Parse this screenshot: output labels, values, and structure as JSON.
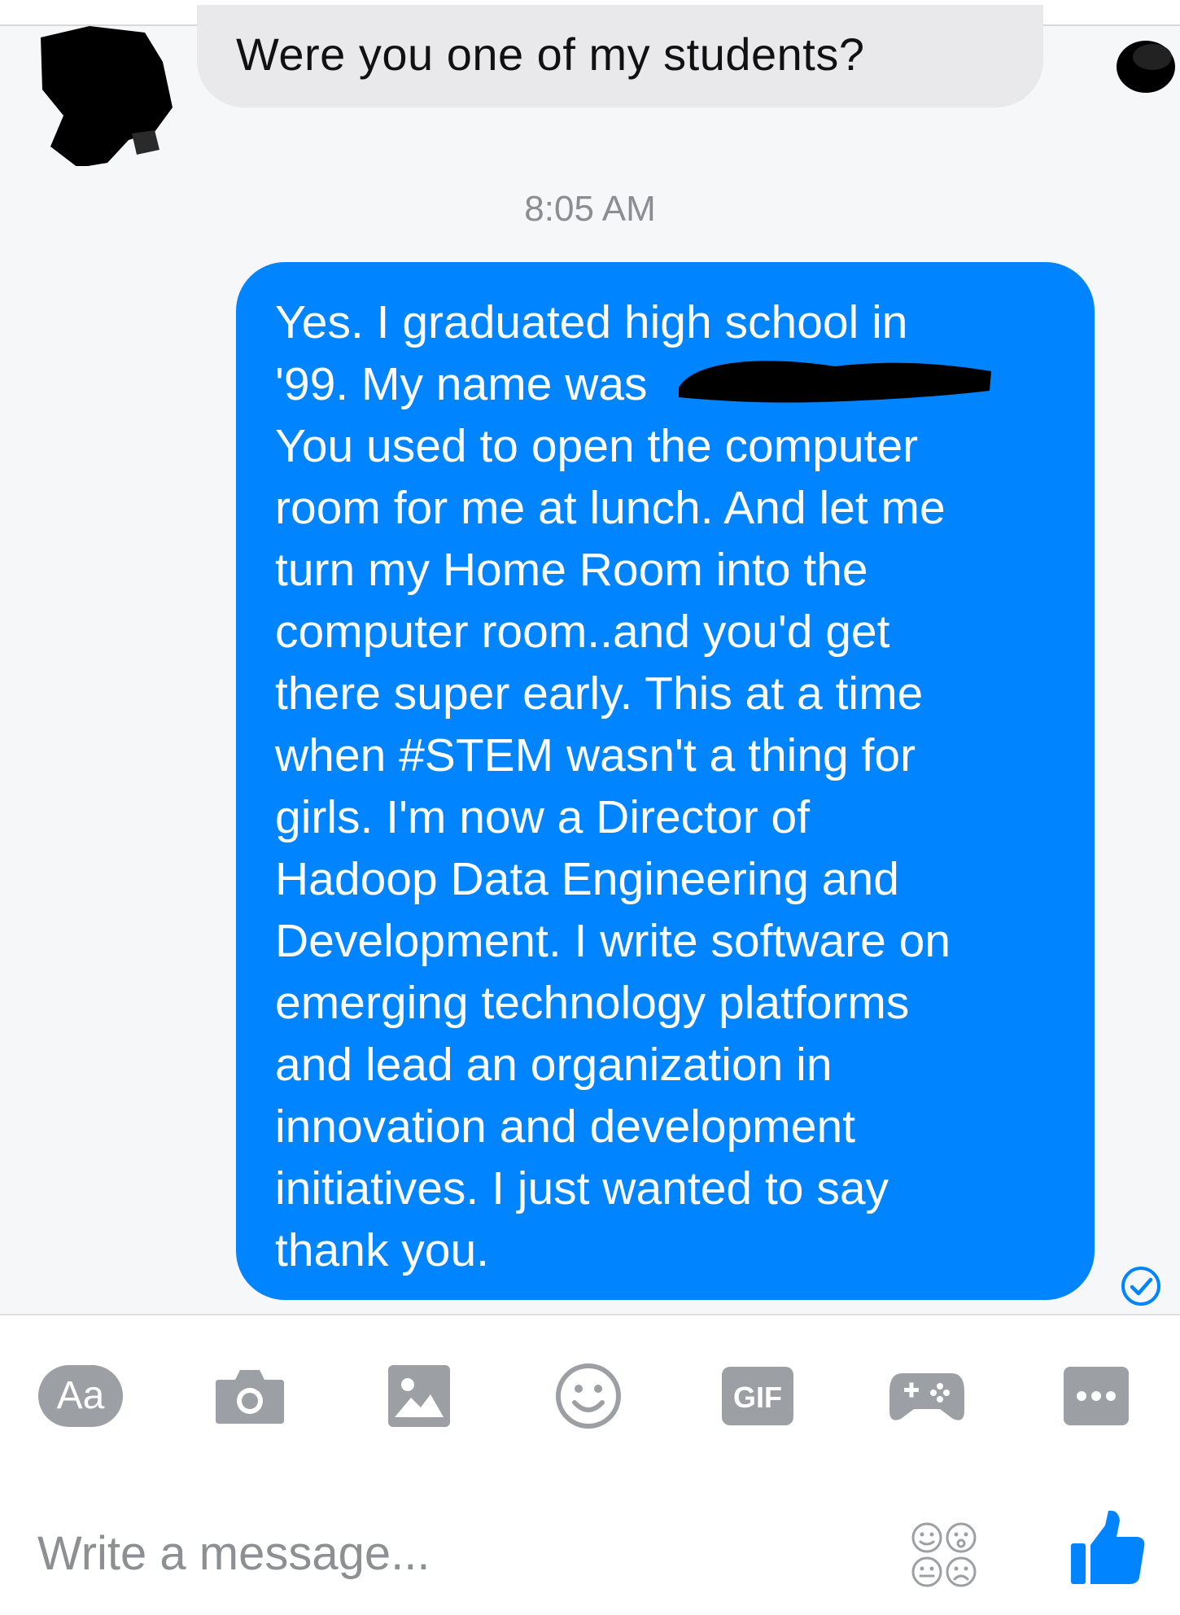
{
  "conversation": {
    "incoming_message": "Were you one of my students?",
    "timestamp": "8:05 AM",
    "outgoing_message_lines": [
      "Yes. I graduated high school in",
      "'99. My name was",
      "You used to open the computer",
      "room for me at lunch. And let me",
      "turn my Home Room into the",
      "computer room..and you'd get",
      "there super early. This at a time",
      "when #STEM wasn't a thing for",
      "girls. I'm now a Director of",
      "Hadoop Data Engineering and",
      "Development. I write software on",
      "emerging technology platforms",
      "and lead an organization in",
      "innovation and development",
      "initiatives. I just wanted to say",
      "thank you."
    ]
  },
  "toolbar": {
    "text_button_label": "Aa",
    "gif_button_label": "GIF",
    "icons": [
      "text-format-icon",
      "camera-icon",
      "image-icon",
      "emoji-icon",
      "gif-icon",
      "game-controller-icon",
      "more-icon"
    ]
  },
  "composer": {
    "placeholder": "Write a message...",
    "value": ""
  },
  "colors": {
    "outgoing_bubble": "#0084ff",
    "incoming_bubble": "#e9e9ec",
    "toolbar_icon": "#9c9fa3"
  }
}
